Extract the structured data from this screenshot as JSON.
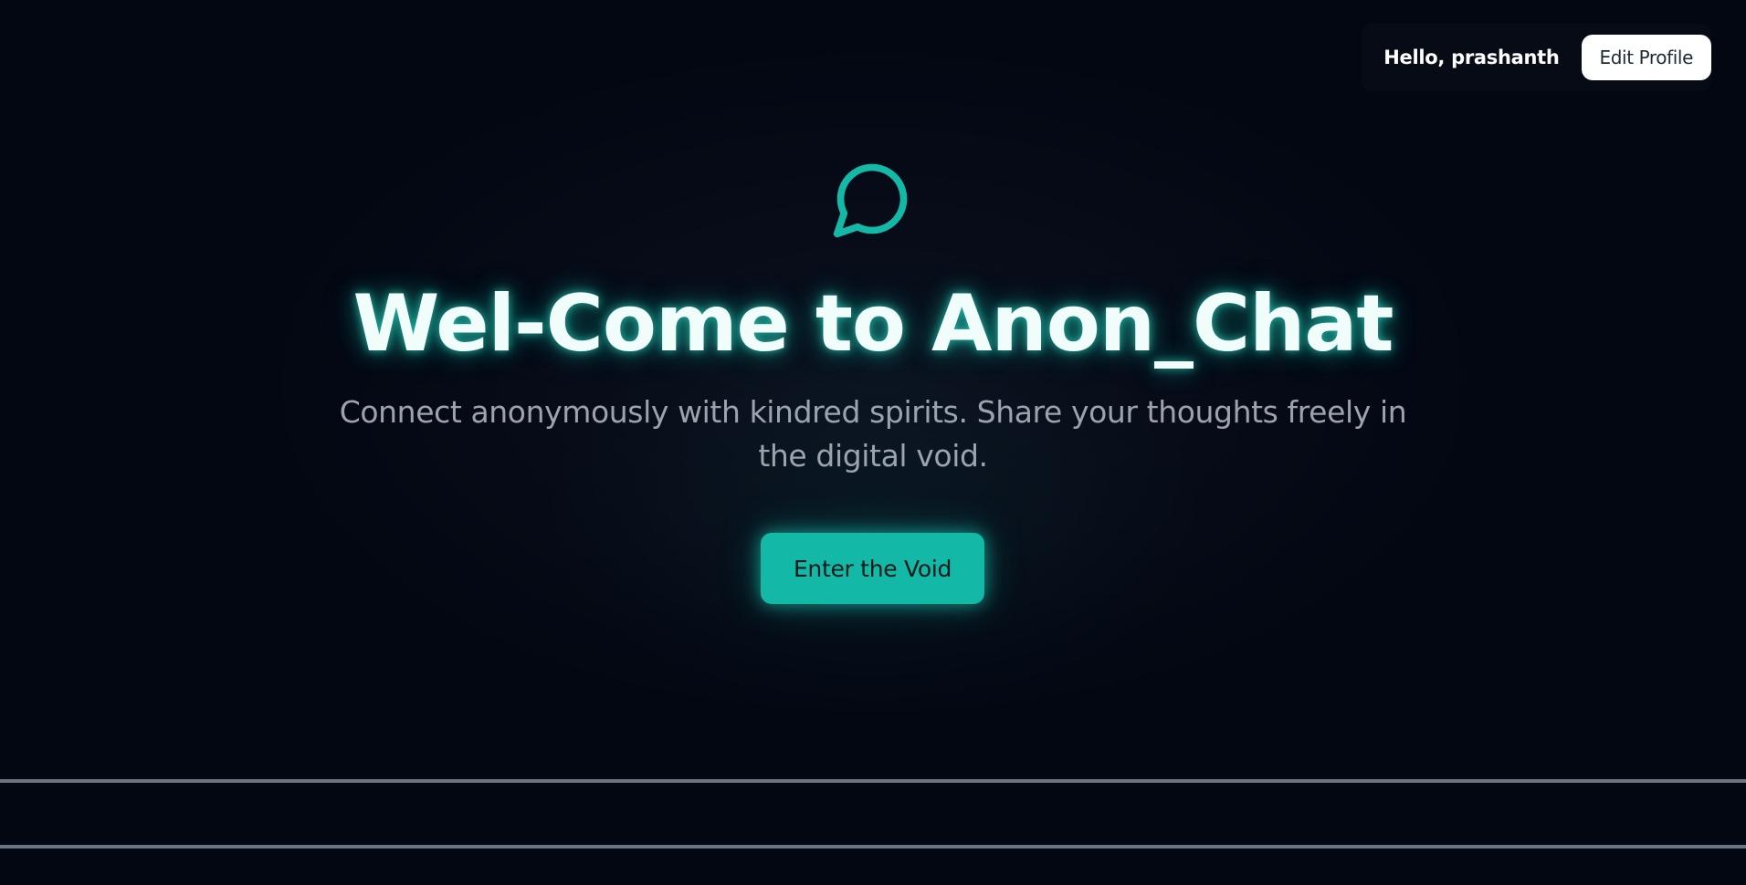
{
  "header": {
    "greeting": "Hello, prashanth",
    "edit_profile_label": "Edit Profile"
  },
  "hero": {
    "icon": "chat-bubble-icon",
    "title": "Wel-Come to Anon_Chat",
    "subtitle": "Connect anonymously with kindred spirits. Share your thoughts freely in the digital void.",
    "cta_label": "Enter the Void"
  },
  "colors": {
    "background": "#030712",
    "accent": "#14b8a6",
    "title": "#f0fdfa",
    "subtitle": "#9ca3af",
    "divider": "#6b7280"
  }
}
